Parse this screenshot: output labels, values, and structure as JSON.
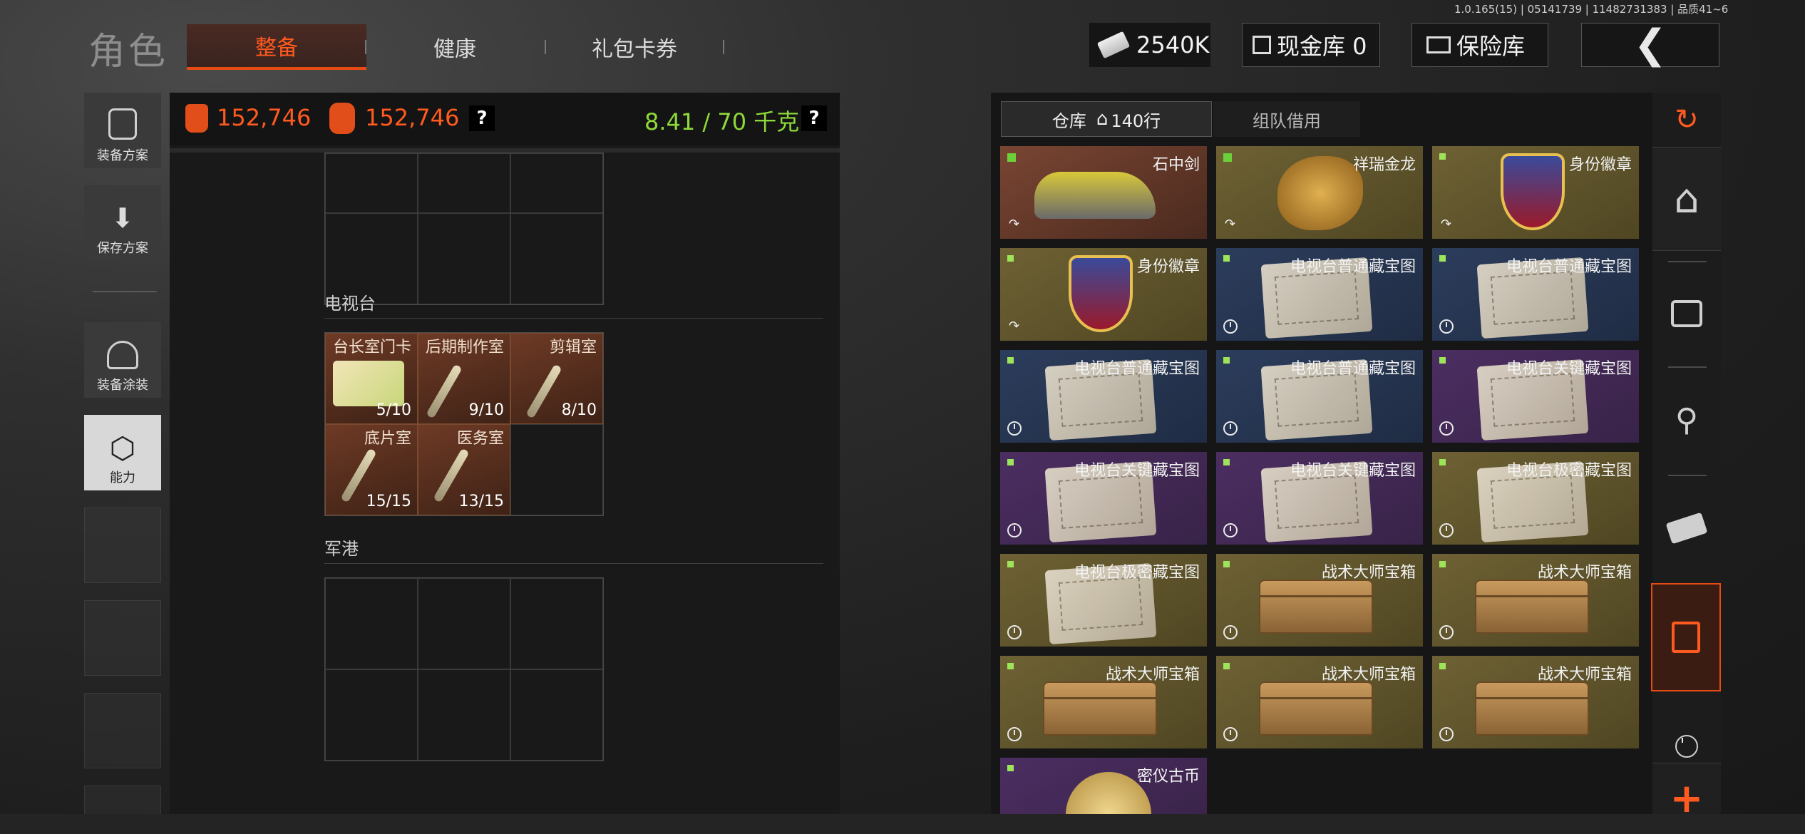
{
  "version": "1.0.165(15) | 05141739 | 11482731383 | 品质41~6",
  "header": {
    "title": "角色",
    "tabs": [
      "整备",
      "健康",
      "礼包卡券"
    ],
    "active_tab": "整备",
    "money": "2540K",
    "cash_vault": "现金库 0",
    "insurance": "保险库",
    "back_icon": "chevron-left-icon"
  },
  "sidebar": [
    {
      "label": "装备方案",
      "icon": "backpack-icon"
    },
    {
      "label": "保存方案",
      "icon": "download-icon"
    },
    {
      "label": "装备涂装",
      "icon": "helmet-icon"
    },
    {
      "label": "能力",
      "icon": "ability-hex-icon"
    }
  ],
  "stats": {
    "value1": "152,746",
    "value2": "152,746",
    "help": "?",
    "weight": "8.41 / 70 千克",
    "help2": "?"
  },
  "sections": {
    "tv": "电视台",
    "port": "军港"
  },
  "keys": [
    {
      "name": "台长室门卡",
      "count": "5/10"
    },
    {
      "name": "后期制作室",
      "count": "9/10"
    },
    {
      "name": "剪辑室",
      "count": "8/10"
    },
    {
      "name": "底片室",
      "count": "15/15"
    },
    {
      "name": "医务室",
      "count": "13/15"
    }
  ],
  "warehouse": {
    "tab_active": "仓库",
    "rows": "140行",
    "tab2": "组队借用"
  },
  "items": [
    {
      "name": "石中剑",
      "rarity": "brown"
    },
    {
      "name": "祥瑞金龙",
      "rarity": "gold"
    },
    {
      "name": "身份徽章",
      "rarity": "gold"
    },
    {
      "name": "身份徽章",
      "rarity": "gold"
    },
    {
      "name": "电视台普通藏宝图",
      "rarity": "blue"
    },
    {
      "name": "电视台普通藏宝图",
      "rarity": "blue"
    },
    {
      "name": "电视台普通藏宝图",
      "rarity": "blue"
    },
    {
      "name": "电视台普通藏宝图",
      "rarity": "blue"
    },
    {
      "name": "电视台关键藏宝图",
      "rarity": "purple"
    },
    {
      "name": "电视台关键藏宝图",
      "rarity": "purple"
    },
    {
      "name": "电视台关键藏宝图",
      "rarity": "purple"
    },
    {
      "name": "电视台极密藏宝图",
      "rarity": "gold"
    },
    {
      "name": "电视台极密藏宝图",
      "rarity": "gold"
    },
    {
      "name": "战术大师宝箱",
      "rarity": "gold"
    },
    {
      "name": "战术大师宝箱",
      "rarity": "gold"
    },
    {
      "name": "战术大师宝箱",
      "rarity": "gold"
    },
    {
      "name": "战术大师宝箱",
      "rarity": "gold"
    },
    {
      "name": "战术大师宝箱",
      "rarity": "gold"
    },
    {
      "name": "密仪古币",
      "rarity": "purple"
    }
  ],
  "right_icons": [
    "sort-refresh-icon",
    "home-icon",
    "cash-icon",
    "key-icon",
    "money-stack-icon",
    "storage-icon",
    "clock-icon",
    "plus-icon"
  ],
  "colors": {
    "accent": "#e84a14",
    "weight_green": "#8ed93a"
  }
}
